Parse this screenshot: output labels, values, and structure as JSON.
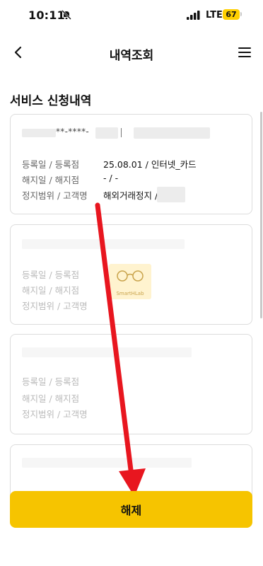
{
  "status_bar": {
    "time": "10:11",
    "network": "LTE",
    "battery": "67"
  },
  "header": {
    "title": "내역조회"
  },
  "section_title": "서비스 신청내역",
  "card1": {
    "masked_id": "**-****-",
    "labels": [
      "등록일 / 등록점",
      "해지일 / 해지점",
      "정지범위 / 고객명"
    ],
    "values": [
      "25.08.01 / 인터넷_카드",
      "- / -",
      "해외거래정지 /"
    ]
  },
  "card2": {
    "labels": [
      "등록일 / 등록점",
      "해지일 / 해지점",
      "정지범위 / 고객명"
    ],
    "watermark": "SmartHLab"
  },
  "card3": {
    "labels": [
      "등록일 / 등록점",
      "해지일 / 해지점",
      "정지범위 / 고객명"
    ]
  },
  "colors": {
    "accent": "#f6c400",
    "arrow": "#e8161f"
  },
  "footer": {
    "button_label": "해제"
  }
}
